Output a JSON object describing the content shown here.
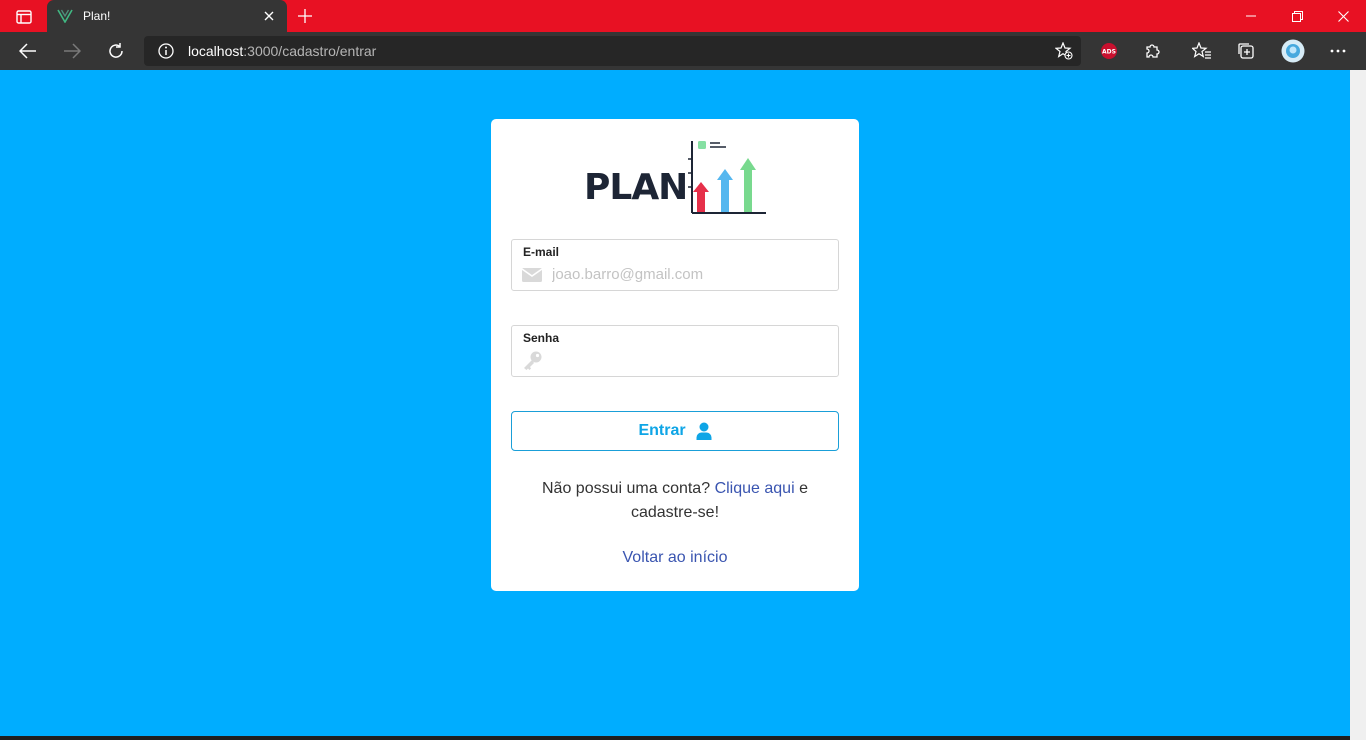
{
  "browser": {
    "tab_title": "Plan!",
    "url_host": "localhost",
    "url_rest": ":3000/cadastro/entrar",
    "extension_badge": "ADS"
  },
  "card": {
    "logo_text": "PLAN",
    "email": {
      "label": "E-mail",
      "placeholder": "joao.barro@gmail.com",
      "value": ""
    },
    "password": {
      "label": "Senha",
      "placeholder": "",
      "value": ""
    },
    "enter_label": "Entrar",
    "signup_prefix": "Não possui uma conta?",
    "signup_link": "Clique aqui",
    "signup_suffix": "e cadastre-se!",
    "back_link": "Voltar ao início"
  },
  "colors": {
    "page_background": "#00adff",
    "titlebar": "#e81123",
    "accent": "#0ea5e6",
    "link": "#3a55b0"
  },
  "icons": {
    "email_field": "envelope-icon",
    "password_field": "key-icon",
    "enter_button": "user-icon"
  }
}
